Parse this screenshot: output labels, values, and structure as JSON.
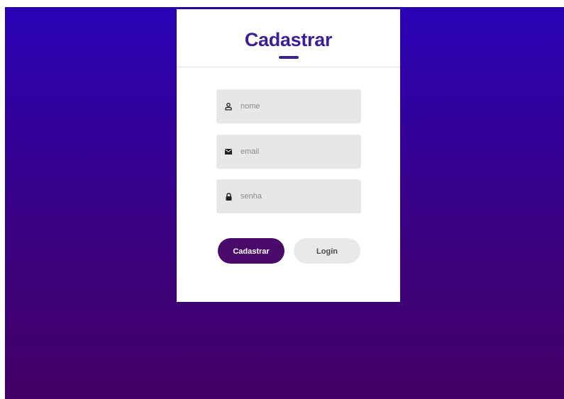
{
  "form": {
    "title": "Cadastrar",
    "fields": [
      {
        "placeholder": "nome",
        "icon": "user-icon"
      },
      {
        "placeholder": "email",
        "icon": "envelope-icon"
      },
      {
        "placeholder": "senha",
        "icon": "lock-icon"
      }
    ],
    "buttons": {
      "primary_label": "Cadastrar",
      "secondary_label": "Login"
    }
  },
  "colors": {
    "gradient_top": "#2a03b6",
    "gradient_bottom": "#430066",
    "title": "#3c1f95",
    "primary_button": "#4a0a6a",
    "field_background": "#e7e7e7"
  }
}
